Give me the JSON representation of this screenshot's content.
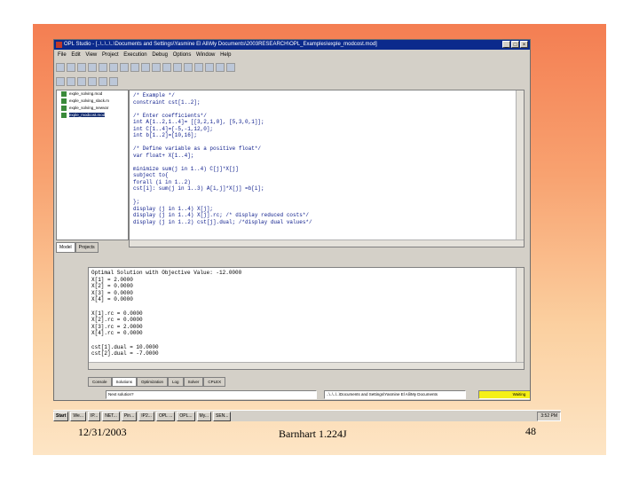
{
  "window": {
    "title": "OPL Studio - [..\\..\\..\\..\\Documents and Settings\\Yasmine El Ali\\My Documents\\2003RESEARCH\\OPL_Examples\\exple_modcost.mod]",
    "buttons": [
      "_",
      "□",
      "×"
    ]
  },
  "menu": [
    "File",
    "Edit",
    "View",
    "Project",
    "Execution",
    "Debug",
    "Options",
    "Window",
    "Help"
  ],
  "tree": {
    "items": [
      "exple_solving.mod",
      "exple_solving_slack.m",
      "exple_solving_newvar",
      "exple_modcost.mod"
    ]
  },
  "tree_tabs": [
    "Model",
    "Projects"
  ],
  "editor_text": "/* Example */\nconstraint cst[1..2];\n\n/* Enter coefficients*/\nint A[1..2,1..4]= [[3,2,1,0], [5,3,0,1]];\nint C[1..4]=[-5,-1,12,0];\nint b[1..2]=[10,16];\n\n/* Define variable as a positive float*/\nvar float+ X[1..4];\n\nminimize sum(j in 1..4) C[j]*X[j]\nsubject to{\nforall (i in 1..2)\ncst[i]: sum(j in 1..3) A[i,j]*X[j] =b[i];\n\n};\ndisplay (j in 1..4) X[j];\ndisplay (j in 1..4) X[j].rc; /* display reduced costs*/\ndisplay (j in 1..2) cst[j].dual; /*display dual values*/",
  "output_text": "Optimal Solution with Objective Value: -12.0000\nX[1] = 2.0000\nX[2] = 0.0000\nX[3] = 0.0000\nX[4] = 0.0000\n\nX[1].rc = 0.0000\nX[2].rc = 0.0000\nX[3].rc = 2.0000\nX[4].rc = 0.0000\n\ncst[1].dual = 10.0000\ncst[2].dual = -7.0000",
  "bottom_tabs": [
    "Console",
    "Solutions",
    "Optimization",
    "Log",
    "Solver",
    "CPLEX"
  ],
  "status": {
    "message": "Next solution?",
    "path": "..\\..\\..\\..\\Documents and Settings\\Yasmine El Ali\\My Documents",
    "state": "Waiting"
  },
  "taskbar": {
    "start": "Start",
    "items": [
      "We...",
      "IP...",
      "NET...",
      "Pin...",
      "IP2...",
      "OPL ...",
      "OPL...",
      "My...",
      "SEN..."
    ],
    "clock": "3:52 PM"
  },
  "footer": {
    "date": "12/31/2003",
    "author": "Barnhart 1.224J",
    "page": "48"
  }
}
